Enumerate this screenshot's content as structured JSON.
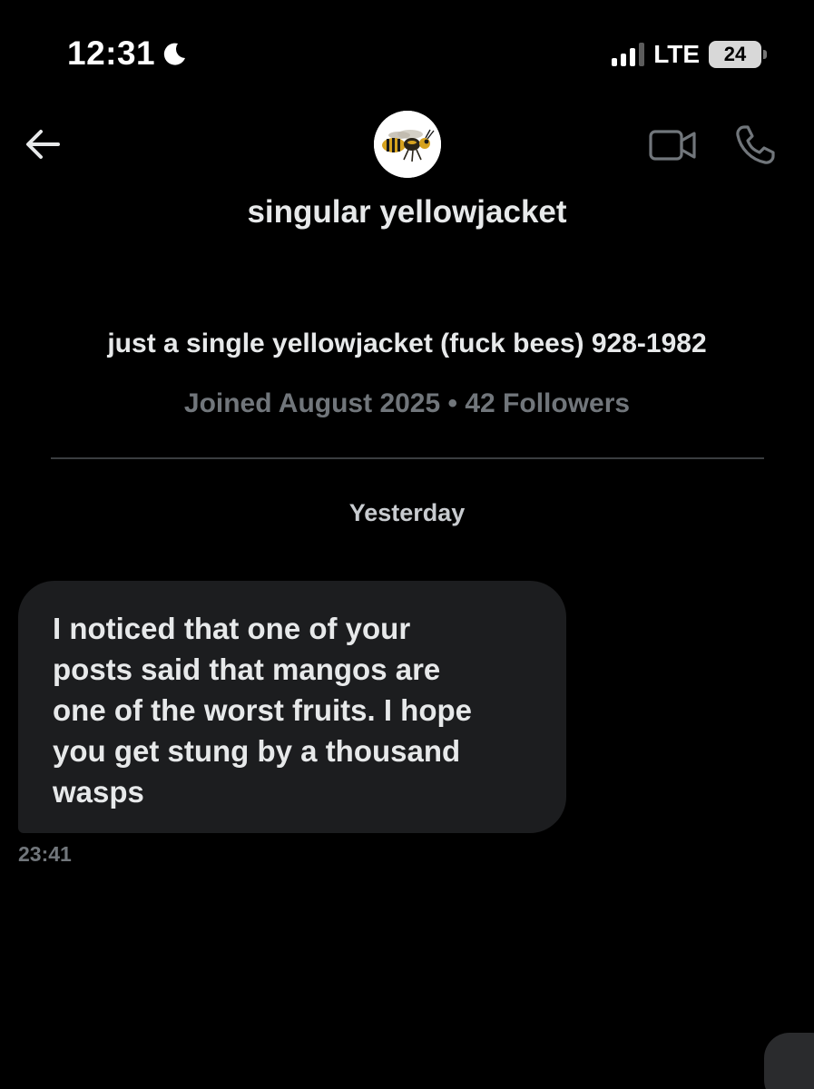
{
  "status_bar": {
    "time": "12:31",
    "network": "LTE",
    "battery": "24"
  },
  "header": {
    "display_name": "singular yellowjacket",
    "avatar_icon": "yellowjacket-wasp-avatar"
  },
  "profile": {
    "bio": "just a single yellowjacket (fuck bees) 928-1982",
    "meta": "Joined August 2025 • 42 Followers"
  },
  "conversation": {
    "day_label": "Yesterday",
    "messages": [
      {
        "lines": [
          "I noticed that one of your",
          "posts said that mangos are",
          "one of the worst fruits. I hope",
          "you get stung by a thousand",
          "wasps"
        ],
        "time": "23:41"
      }
    ]
  },
  "colors": {
    "background": "#000000",
    "text_primary": "#e7e9ea",
    "text_secondary": "#71767b",
    "bubble": "#1c1d1f",
    "divider": "#3a3d40"
  }
}
